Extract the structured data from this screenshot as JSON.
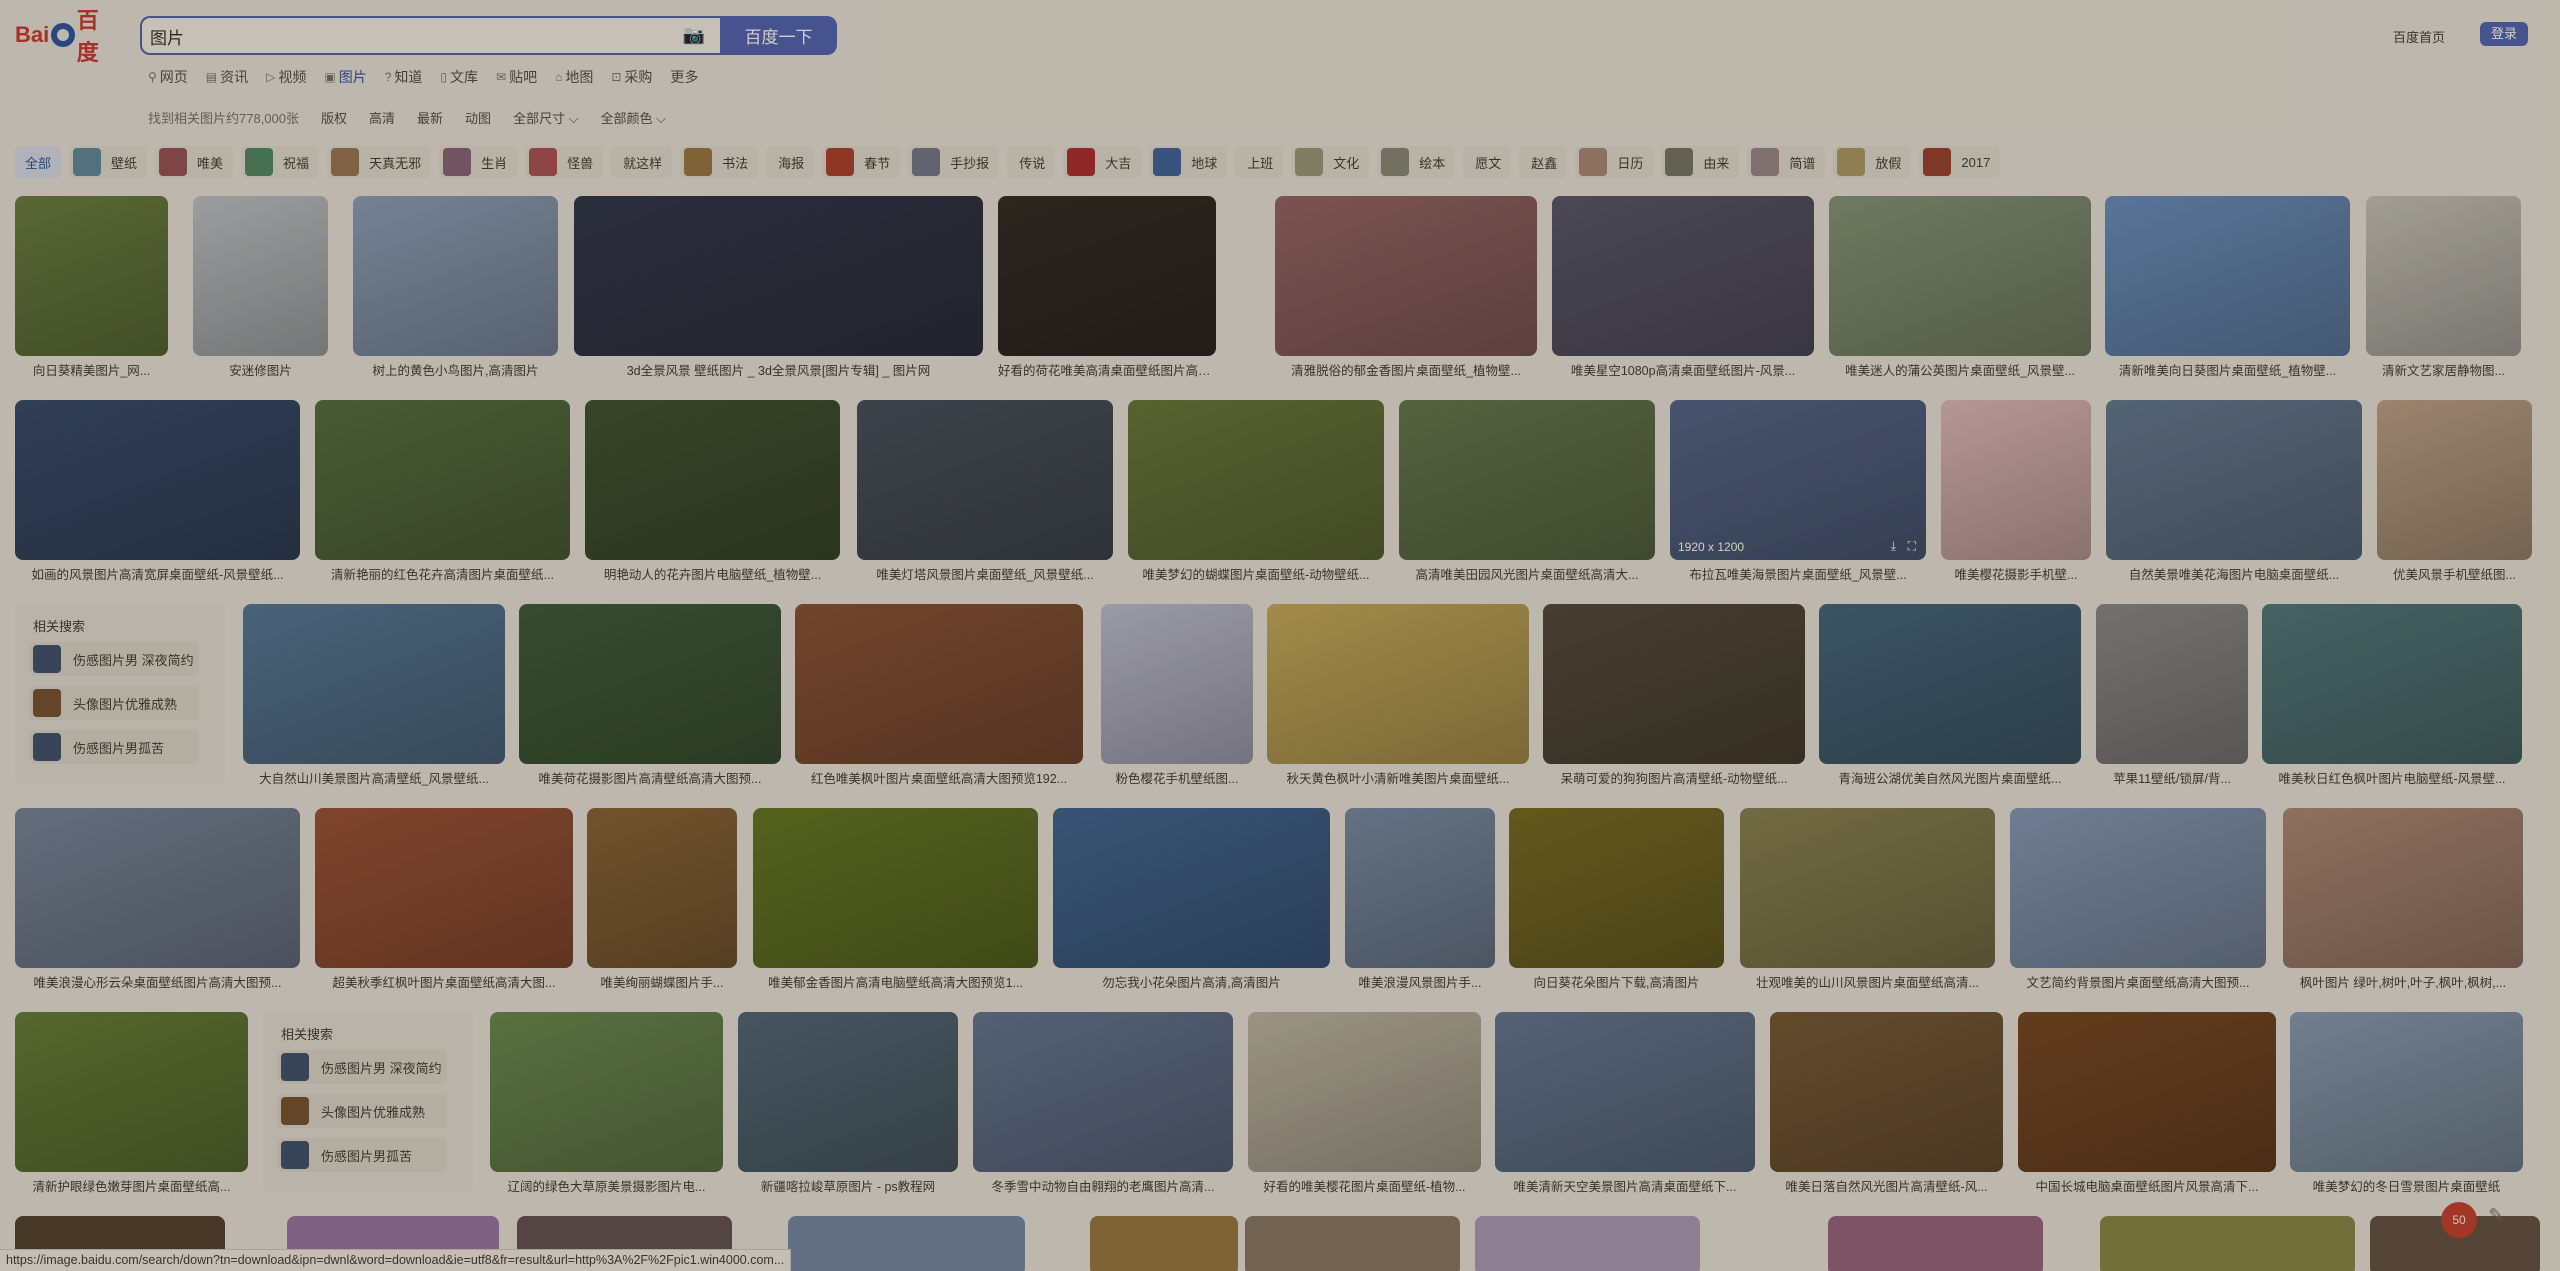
{
  "header": {
    "logo_text": "Bai百度",
    "search_value": "图片",
    "search_button": "百度一下",
    "home_link": "百度首页",
    "login_button": "登录"
  },
  "nav": [
    {
      "label": "网页",
      "icon": "search-icon"
    },
    {
      "label": "资讯",
      "icon": "news-icon"
    },
    {
      "label": "视频",
      "icon": "video-icon"
    },
    {
      "label": "图片",
      "icon": "image-icon"
    },
    {
      "label": "知道",
      "icon": "question-icon"
    },
    {
      "label": "文库",
      "icon": "doc-icon"
    },
    {
      "label": "贴吧",
      "icon": "tieba-icon"
    },
    {
      "label": "地图",
      "icon": "map-icon"
    },
    {
      "label": "采购",
      "icon": "cart-icon"
    },
    {
      "label": "更多",
      "icon": ""
    }
  ],
  "filter": {
    "result_count": "找到相关图片约778,000张",
    "items": [
      "版权",
      "高清",
      "最新",
      "动图",
      "全部尺寸 ⌵",
      "全部颜色 ⌵"
    ]
  },
  "tags": [
    "全部",
    "壁纸",
    "唯美",
    "祝福",
    "天真无邪",
    "生肖",
    "怪兽",
    "就这样",
    "书法",
    "海报",
    "春节",
    "手抄报",
    "传说",
    "大吉",
    "地球",
    "上班",
    "文化",
    "绘本",
    "愿文",
    "赵鑫",
    "日历",
    "由来",
    "简谱",
    "放假",
    "2017"
  ],
  "related": {
    "title": "相关搜索",
    "items": [
      "伤感图片男 深夜简约",
      "头像图片优雅成熟",
      "伤感图片男孤苦"
    ]
  },
  "images": [
    {
      "caption": "向日葵精美图片_网...",
      "color": "#5e7038"
    },
    {
      "caption": "安迷修图片",
      "color": "#a9acae"
    },
    {
      "caption": "树上的黄色小鸟图片,高清图片",
      "color": "#7e8ea3"
    },
    {
      "caption": "3d全景风景 壁纸图片 _ 3d全景风景[图片专辑] _ 图片网",
      "color": "#2c3040"
    },
    {
      "caption": "好看的荷花唯美高清桌面壁纸图片高清...",
      "color": "#2d2721"
    },
    {
      "caption": "清雅脱俗的郁金香图片桌面壁纸_植物壁...",
      "color": "#845a5a"
    },
    {
      "caption": "唯美星空1080p高清桌面壁纸图片-风景...",
      "color": "#4f4d5e"
    },
    {
      "caption": "唯美迷人的蒲公英图片桌面壁纸_风景壁...",
      "color": "#78856a"
    },
    {
      "caption": "清新唯美向日葵图片桌面壁纸_植物壁...",
      "color": "#5f7fa8"
    },
    {
      "caption": "清新文艺家居静物图...",
      "color": "#b0ada4"
    },
    {
      "caption": "如画的风景图片高清宽屏桌面壁纸-风景壁纸...",
      "color": "#31425e"
    },
    {
      "caption": "清新艳丽的红色花卉高清图片桌面壁纸...",
      "color": "#4d6238"
    },
    {
      "caption": "明艳动人的花卉图片电脑壁纸_植物壁...",
      "color": "#3a4a2c"
    },
    {
      "caption": "唯美灯塔风景图片桌面壁纸_风景壁纸...",
      "color": "#404850"
    },
    {
      "caption": "唯美梦幻的蝴蝶图片桌面壁纸-动物壁纸...",
      "color": "#5e6a34"
    },
    {
      "caption": "高清唯美田园风光图片桌面壁纸高清大...",
      "color": "#5a6a44"
    },
    {
      "caption": "布拉瓦唯美海景图片桌面壁纸_风景壁...",
      "color": "#4c5a78",
      "dims": "1920 x 1200"
    },
    {
      "caption": "唯美樱花摄影手机壁...",
      "color": "#c7a5a4"
    },
    {
      "caption": "自然美景唯美花海图片电脑桌面壁纸...",
      "color": "#5a6c80"
    },
    {
      "caption": "优美风景手机壁纸图...",
      "color": "#a89078"
    },
    {
      "caption": "大自然山川美景图片高清壁纸_风景壁纸...",
      "color": "#4e6a84"
    },
    {
      "caption": "唯美荷花摄影图片高清壁纸高清大图预...",
      "color": "#3a5234"
    },
    {
      "caption": "红色唯美枫叶图片桌面壁纸高清大图预览192...",
      "color": "#7a4a30"
    },
    {
      "caption": "粉色樱花手机壁纸图...",
      "color": "#a8a8b8"
    },
    {
      "caption": "秋天黄色枫叶小清新唯美图片桌面壁纸...",
      "color": "#b09850"
    },
    {
      "caption": "呆萌可爱的狗狗图片高清壁纸-动物壁纸...",
      "color": "#4a4234"
    },
    {
      "caption": "青海班公湖优美自然风光图片桌面壁纸...",
      "color": "#3e5a6c"
    },
    {
      "caption": "苹果11壁纸/锁屏/背...",
      "color": "#7c7c7a"
    },
    {
      "caption": "唯美秋日红色枫叶图片电脑壁纸-风景壁...",
      "color": "#4a6a6c"
    },
    {
      "caption": "唯美浪漫心形云朵桌面壁纸图片高清大图预...",
      "color": "#6a7688"
    },
    {
      "caption": "超美秋季红枫叶图片桌面壁纸高清大图...",
      "color": "#8a4a30"
    },
    {
      "caption": "唯美绚丽蝴蝶图片手...",
      "color": "#7a5a30"
    },
    {
      "caption": "唯美郁金香图片高清电脑壁纸高清大图预览1...",
      "color": "#5a6a20"
    },
    {
      "caption": "勿忘我小花朵图片高清,高清图片",
      "color": "#3a5a80"
    },
    {
      "caption": "唯美浪漫风景图片手...",
      "color": "#6c7c90"
    },
    {
      "caption": "向日葵花朵图片下载,高清图片",
      "color": "#6a6020"
    },
    {
      "caption": "壮观唯美的山川风景图片桌面壁纸高清...",
      "color": "#7a7448"
    },
    {
      "caption": "文艺简约背景图片桌面壁纸高清大图预...",
      "color": "#7888a0"
    },
    {
      "caption": "枫叶图片 绿叶,树叶,叶子,枫叶,枫树,...",
      "color": "#9a7a68"
    },
    {
      "caption": "清新护眼绿色嫩芽图片桌面壁纸高...",
      "color": "#5a7030"
    },
    {
      "caption": "辽阔的绿色大草原美景摄影图片电...",
      "color": "#607a48"
    },
    {
      "caption": "新疆喀拉峻草原图片 - ps教程网",
      "color": "#4a5c68"
    },
    {
      "caption": "冬季雪中动物自由翱翔的老鹰图片高清...",
      "color": "#5a6880"
    },
    {
      "caption": "好看的唯美樱花图片桌面壁纸-植物...",
      "color": "#a8a290"
    },
    {
      "caption": "唯美清新天空美景图片高清桌面壁纸下...",
      "color": "#5a6a80"
    },
    {
      "caption": "唯美日落自然风光图片高清壁纸-风...",
      "color": "#6a5030"
    },
    {
      "caption": "中国长城电脑桌面壁纸图片风景高清下...",
      "color": "#6a4020"
    },
    {
      "caption": "唯美梦幻的冬日雪景图片桌面壁纸",
      "color": "#7a8a9c"
    }
  ],
  "bottom_row_colors": [
    "#4a3a2a",
    "#8a6a90",
    "#5a4a4a",
    "#6a7a90",
    "#8a6a3a",
    "#7a6a5a",
    "#9a8aa0",
    "#8a5a70",
    "#7a7a40",
    "#5a4a3a"
  ],
  "status_bar": "https://image.baidu.com/search/down?tn=download&ipn=dwnl&word=download&ie=utf8&fr=result&url=http%3A%2F%2Fpic1.win4000.com...",
  "feedback_count": "50"
}
